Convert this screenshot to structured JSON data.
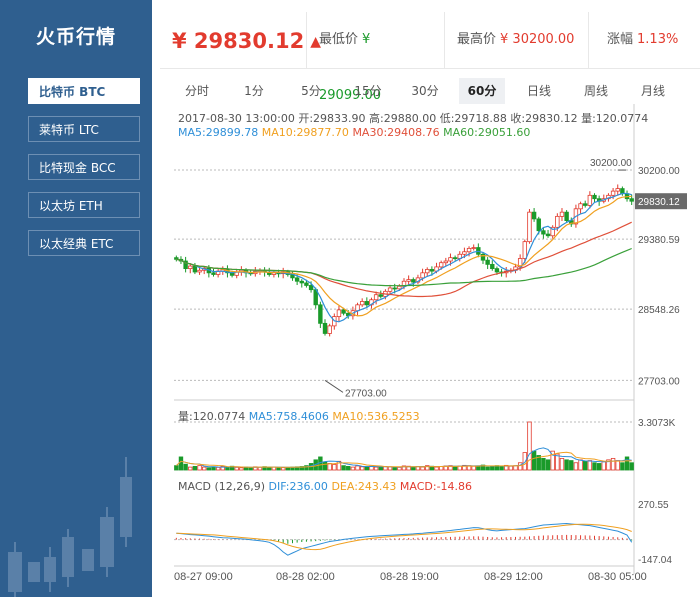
{
  "app_title": "火币行情",
  "sidebar": {
    "items": [
      {
        "label": "比特币 BTC",
        "active": true
      },
      {
        "label": "莱特币 LTC",
        "active": false
      },
      {
        "label": "比特现金 BCC",
        "active": false
      },
      {
        "label": "以太坊 ETH",
        "active": false
      },
      {
        "label": "以太经典 ETC",
        "active": false
      }
    ]
  },
  "ticker": {
    "price": "¥ 29830.12",
    "low_label": "最低价",
    "low_value": "¥ 29099.00",
    "high_label": "最高价",
    "high_value": "¥ 30200.00",
    "change_label": "涨幅",
    "change_value": "1.13%",
    "colors": {
      "up": "#e23b2e",
      "down": "#1a9a2a"
    }
  },
  "tabs": [
    {
      "label": "分时",
      "active": false
    },
    {
      "label": "1分",
      "active": false
    },
    {
      "label": "5分",
      "active": false
    },
    {
      "label": "15分",
      "active": false
    },
    {
      "label": "30分",
      "active": false
    },
    {
      "label": "60分",
      "active": true
    },
    {
      "label": "日线",
      "active": false
    },
    {
      "label": "周线",
      "active": false
    },
    {
      "label": "月线",
      "active": false
    }
  ],
  "chart_data": {
    "type": "candlestick",
    "ohlc_info": "2017-08-30 13:00:00  开:29833.90 高:29880.00 低:29718.88 收:29830.12 量:120.0774",
    "ma_info": [
      {
        "text": "MA5:29899.78",
        "color": "#2f8fd8"
      },
      {
        "text": "MA10:29877.70",
        "color": "#f0a020"
      },
      {
        "text": "MA30:29408.76",
        "color": "#e0503a"
      },
      {
        "text": "MA60:29051.60",
        "color": "#3aa03a"
      }
    ],
    "price_ylim": [
      27470,
      30450
    ],
    "price_ticks": [
      "30200.00",
      "29380.59",
      "28548.26",
      "27703.00"
    ],
    "current_price_tag": "29830.12",
    "high_marker": "30200.00",
    "low_marker": "27703.00",
    "volume_info": [
      {
        "text": "量:120.0774",
        "color": "#555555"
      },
      {
        "text": "MA5:758.4606",
        "color": "#2f8fd8"
      },
      {
        "text": "MA10:536.5253",
        "color": "#f0a020"
      }
    ],
    "volume_tick": "3.3073K",
    "volume_max": 3307,
    "macd_info": [
      {
        "text": "MACD (12,26,9)",
        "color": "#555555"
      },
      {
        "text": "DIF:236.00",
        "color": "#2f8fd8"
      },
      {
        "text": "DEA:243.43",
        "color": "#f0a020"
      },
      {
        "text": "MACD:-14.86",
        "color": "#e23b2e"
      }
    ],
    "macd_ticks": [
      "270.55",
      "-147.04"
    ],
    "macd_ylim": [
      -147.04,
      270.55
    ],
    "x_labels": [
      "08-27 09:00",
      "08-28 02:00",
      "08-28 19:00",
      "08-29 12:00",
      "08-30 05:00"
    ],
    "series_close": [
      29140,
      29120,
      29030,
      29060,
      28990,
      29010,
      29035,
      28980,
      28960,
      29000,
      29020,
      28980,
      28950,
      28990,
      29010,
      28980,
      28970,
      29000,
      29010,
      28990,
      28960,
      28980,
      28970,
      28990,
      28960,
      28920,
      28880,
      28860,
      28830,
      28780,
      28600,
      28380,
      28260,
      28350,
      28460,
      28540,
      28500,
      28470,
      28530,
      28600,
      28640,
      28600,
      28660,
      28720,
      28700,
      28760,
      28800,
      28790,
      28820,
      28880,
      28900,
      28870,
      28920,
      28980,
      29020,
      29000,
      29050,
      29100,
      29120,
      29160,
      29150,
      29200,
      29230,
      29270,
      29280,
      29200,
      29130,
      29080,
      29030,
      28990,
      28980,
      29000,
      29010,
      29050,
      29150,
      29350,
      29700,
      29620,
      29480,
      29440,
      29420,
      29520,
      29650,
      29700,
      29600,
      29560,
      29740,
      29800,
      29780,
      29900,
      29860,
      29830,
      29860,
      29900,
      29950,
      29980,
      29920,
      29860,
      29830
    ],
    "series_vol": [
      300,
      900,
      400,
      200,
      250,
      300,
      200,
      150,
      220,
      180,
      250,
      200,
      260,
      180,
      150,
      200,
      160,
      220,
      190,
      230,
      210,
      200,
      170,
      160,
      180,
      200,
      220,
      240,
      300,
      450,
      700,
      900,
      550,
      450,
      380,
      600,
      300,
      250,
      200,
      280,
      220,
      240,
      260,
      200,
      180,
      240,
      220,
      200,
      180,
      280,
      260,
      220,
      240,
      200,
      300,
      260,
      200,
      240,
      280,
      300,
      260,
      280,
      320,
      300,
      260,
      280,
      340,
      200,
      260,
      300,
      280,
      320,
      260,
      300,
      500,
      1200,
      3307,
      1300,
      1000,
      800,
      700,
      1300,
      1100,
      800,
      700,
      650,
      500,
      700,
      600,
      650,
      500,
      450,
      600,
      700,
      800,
      650,
      500,
      900,
      500
    ],
    "series_macd": [
      30,
      28,
      25,
      22,
      20,
      18,
      15,
      13,
      10,
      8,
      6,
      5,
      4,
      3,
      2,
      1,
      0,
      -2,
      -4,
      -6,
      -10,
      -20,
      -35,
      -55,
      -70,
      -60,
      -50,
      -40,
      -35,
      -30,
      -25,
      -20,
      -15,
      -10,
      -8,
      -5,
      -2,
      0,
      3,
      5,
      8,
      10,
      12,
      14,
      16,
      18,
      20,
      22,
      24,
      26,
      28,
      30,
      32,
      34,
      36,
      38,
      40,
      42,
      44,
      46,
      48,
      50,
      52,
      54,
      56,
      55,
      50,
      45,
      40,
      38,
      40,
      42,
      44,
      46,
      48,
      50,
      55,
      60,
      65,
      70,
      72,
      74,
      76,
      78,
      80,
      78,
      76,
      74,
      72,
      70,
      65,
      60,
      55,
      50,
      45,
      40,
      30,
      20,
      -15
    ]
  }
}
